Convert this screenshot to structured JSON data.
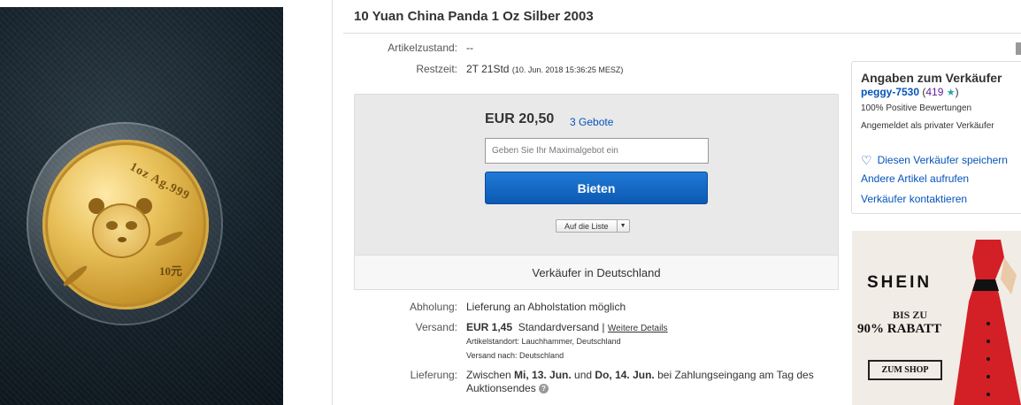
{
  "item": {
    "title": "10 Yuan China Panda 1 Oz Silber 2003"
  },
  "photo": {
    "inscription": "1oz Ag.999",
    "denomination": "10元"
  },
  "details": {
    "condition_label": "Artikelzustand:",
    "condition_value": "--",
    "time_left_label": "Restzeit:",
    "time_left_value": "2T 21Std",
    "time_left_date": "(10. Jun. 2018   15:36:25 MESZ)"
  },
  "bid": {
    "price": "EUR 20,50",
    "bid_count": "3 Gebote",
    "max_bid_placeholder": "Geben Sie Ihr Maximalgebot ein",
    "bid_button": "Bieten",
    "watch_button": "Auf die Liste",
    "watch_arrow": "▼",
    "seller_location": "Verkäufer in Deutschland"
  },
  "shipping": {
    "pickup_label": "Abholung:",
    "pickup_value": "Lieferung an Abholstation möglich",
    "shipping_label": "Versand:",
    "shipping_price": "EUR 1,45",
    "shipping_method": "Standardversand |",
    "more_details": "Weitere Details",
    "item_location": "Artikelstandort:  Lauchhammer, Deutschland",
    "ships_to": "Versand nach:  Deutschland",
    "delivery_label": "Lieferung:",
    "delivery_prefix": "Zwischen ",
    "delivery_from": "Mi, 13. Jun.",
    "delivery_mid": " und ",
    "delivery_to": "Do, 14. Jun.",
    "delivery_suffix": " bei Zahlungseingang am Tag des",
    "delivery_line2": "Auktionsendes",
    "help_icon": "?"
  },
  "seller": {
    "heading": "Angaben zum Verkäufer",
    "name": "peggy-7530",
    "score_open": " (",
    "score": "419",
    "star": "★",
    "score_close": ")",
    "positive": "100% Positive Bewertungen",
    "account_type": "Angemeldet als privater Verkäufer",
    "save_seller": "Diesen Verkäufer speichern",
    "other_items": "Andere Artikel aufrufen",
    "contact": "Verkäufer kontaktieren",
    "heart_icon": "♡"
  },
  "ad": {
    "brand": "SHEIN",
    "line1": "BIS ZU",
    "line2": "90% RABATT",
    "button": "ZUM SHOP"
  },
  "colors": {
    "link_blue": "#0654ba",
    "bid_button": "#0c59b3",
    "ad_dress": "#d31f26"
  }
}
